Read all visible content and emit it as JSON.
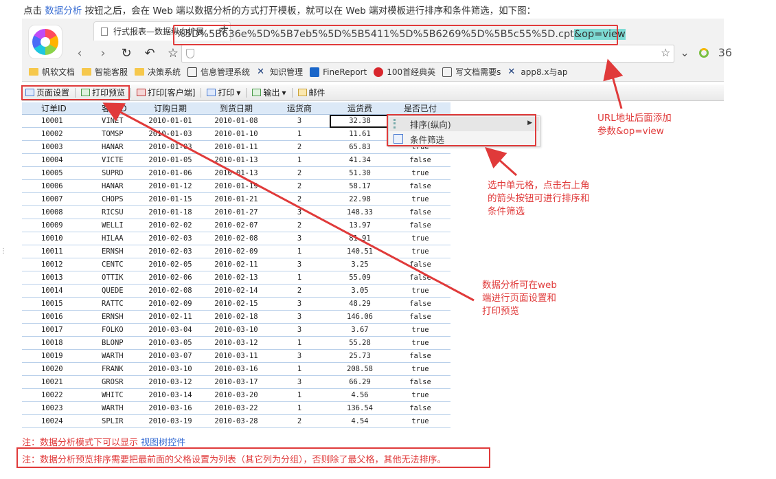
{
  "intro": {
    "pre": "点击 ",
    "link": "数据分析",
    "post": " 按钮之后，会在 Web 端以数据分析的方式打开模板，就可以在 Web 端对模板进行排序和条件筛选，如下图："
  },
  "browser": {
    "tab_title": "行式报表—数据纵向扩展",
    "tab_close": "✕",
    "new_tab": "+",
    "url_prefix": "%5D%5B636e%5D%5B7eb5%5D%5B5411%5D%5B6269%5D%5B5c55%5D.cpt",
    "url_highlight": "&op=view",
    "addr_right_text": "36",
    "bookmarks": [
      "帆软文档",
      "智能客服",
      "决策系统",
      "信息管理系统",
      "知识管理",
      "FineReport",
      "100首经典英",
      "写文档需要s",
      "app8.x与ap"
    ]
  },
  "toolbar": {
    "items": [
      "页面设置",
      "打印预览",
      "打印[客户端]",
      "打印",
      "输出",
      "邮件"
    ]
  },
  "table": {
    "headers": [
      "订单ID",
      "客户ID",
      "订购日期",
      "到货日期",
      "运货商",
      "运货费",
      "是否已付"
    ],
    "rows": [
      [
        "10001",
        "VINET",
        "2010-01-01",
        "2010-01-08",
        "3",
        "32.38",
        ""
      ],
      [
        "10002",
        "TOMSP",
        "2010-01-03",
        "2010-01-10",
        "1",
        "11.61",
        ""
      ],
      [
        "10003",
        "HANAR",
        "2010-01-03",
        "2010-01-11",
        "2",
        "65.83",
        "true"
      ],
      [
        "10004",
        "VICTE",
        "2010-01-05",
        "2010-01-13",
        "1",
        "41.34",
        "false"
      ],
      [
        "10005",
        "SUPRD",
        "2010-01-06",
        "2010-01-13",
        "2",
        "51.30",
        "true"
      ],
      [
        "10006",
        "HANAR",
        "2010-01-12",
        "2010-01-19",
        "2",
        "58.17",
        "false"
      ],
      [
        "10007",
        "CHOPS",
        "2010-01-15",
        "2010-01-21",
        "2",
        "22.98",
        "true"
      ],
      [
        "10008",
        "RICSU",
        "2010-01-18",
        "2010-01-27",
        "3",
        "148.33",
        "false"
      ],
      [
        "10009",
        "WELLI",
        "2010-02-02",
        "2010-02-07",
        "2",
        "13.97",
        "false"
      ],
      [
        "10010",
        "HILAA",
        "2010-02-03",
        "2010-02-08",
        "3",
        "81.91",
        "true"
      ],
      [
        "10011",
        "ERNSH",
        "2010-02-03",
        "2010-02-09",
        "1",
        "140.51",
        "true"
      ],
      [
        "10012",
        "CENTC",
        "2010-02-05",
        "2010-02-11",
        "3",
        "3.25",
        "false"
      ],
      [
        "10013",
        "OTTIK",
        "2010-02-06",
        "2010-02-13",
        "1",
        "55.09",
        "false"
      ],
      [
        "10014",
        "QUEDE",
        "2010-02-08",
        "2010-02-14",
        "2",
        "3.05",
        "true"
      ],
      [
        "10015",
        "RATTC",
        "2010-02-09",
        "2010-02-15",
        "3",
        "48.29",
        "false"
      ],
      [
        "10016",
        "ERNSH",
        "2010-02-11",
        "2010-02-18",
        "3",
        "146.06",
        "false"
      ],
      [
        "10017",
        "FOLKO",
        "2010-03-04",
        "2010-03-10",
        "3",
        "3.67",
        "true"
      ],
      [
        "10018",
        "BLONP",
        "2010-03-05",
        "2010-03-12",
        "1",
        "55.28",
        "true"
      ],
      [
        "10019",
        "WARTH",
        "2010-03-07",
        "2010-03-11",
        "3",
        "25.73",
        "false"
      ],
      [
        "10020",
        "FRANK",
        "2010-03-10",
        "2010-03-16",
        "1",
        "208.58",
        "true"
      ],
      [
        "10021",
        "GROSR",
        "2010-03-12",
        "2010-03-17",
        "3",
        "66.29",
        "false"
      ],
      [
        "10022",
        "WHITC",
        "2010-03-14",
        "2010-03-20",
        "1",
        "4.56",
        "true"
      ],
      [
        "10023",
        "WARTH",
        "2010-03-16",
        "2010-03-22",
        "1",
        "136.54",
        "false"
      ],
      [
        "10024",
        "SPLIR",
        "2010-03-19",
        "2010-03-28",
        "2",
        "4.54",
        "true"
      ]
    ]
  },
  "menu": {
    "sort_label": "排序(纵向)",
    "filter_label": "条件筛选"
  },
  "annotations": {
    "url": [
      "URL地址后面添加",
      "参数&op=view"
    ],
    "cell": [
      "选中单元格，点击右上角",
      "的箭头按钮可进行排序和",
      "条件筛选"
    ],
    "toolbar": [
      "数据分析可在web",
      "端进行页面设置和",
      "打印预览"
    ]
  },
  "notes": {
    "note1_pre": "注：数据分析模式下可以显示 ",
    "note1_link": "视图树控件",
    "note2": "注：数据分析预览排序需要把最前面的父格设置为列表（其它列为分组），否则除了最父格，其他无法排序。"
  },
  "colors": {
    "accent_red": "#e03a3a",
    "link_blue": "#3b6fd4",
    "url_highlight": "#7ddbd4"
  }
}
